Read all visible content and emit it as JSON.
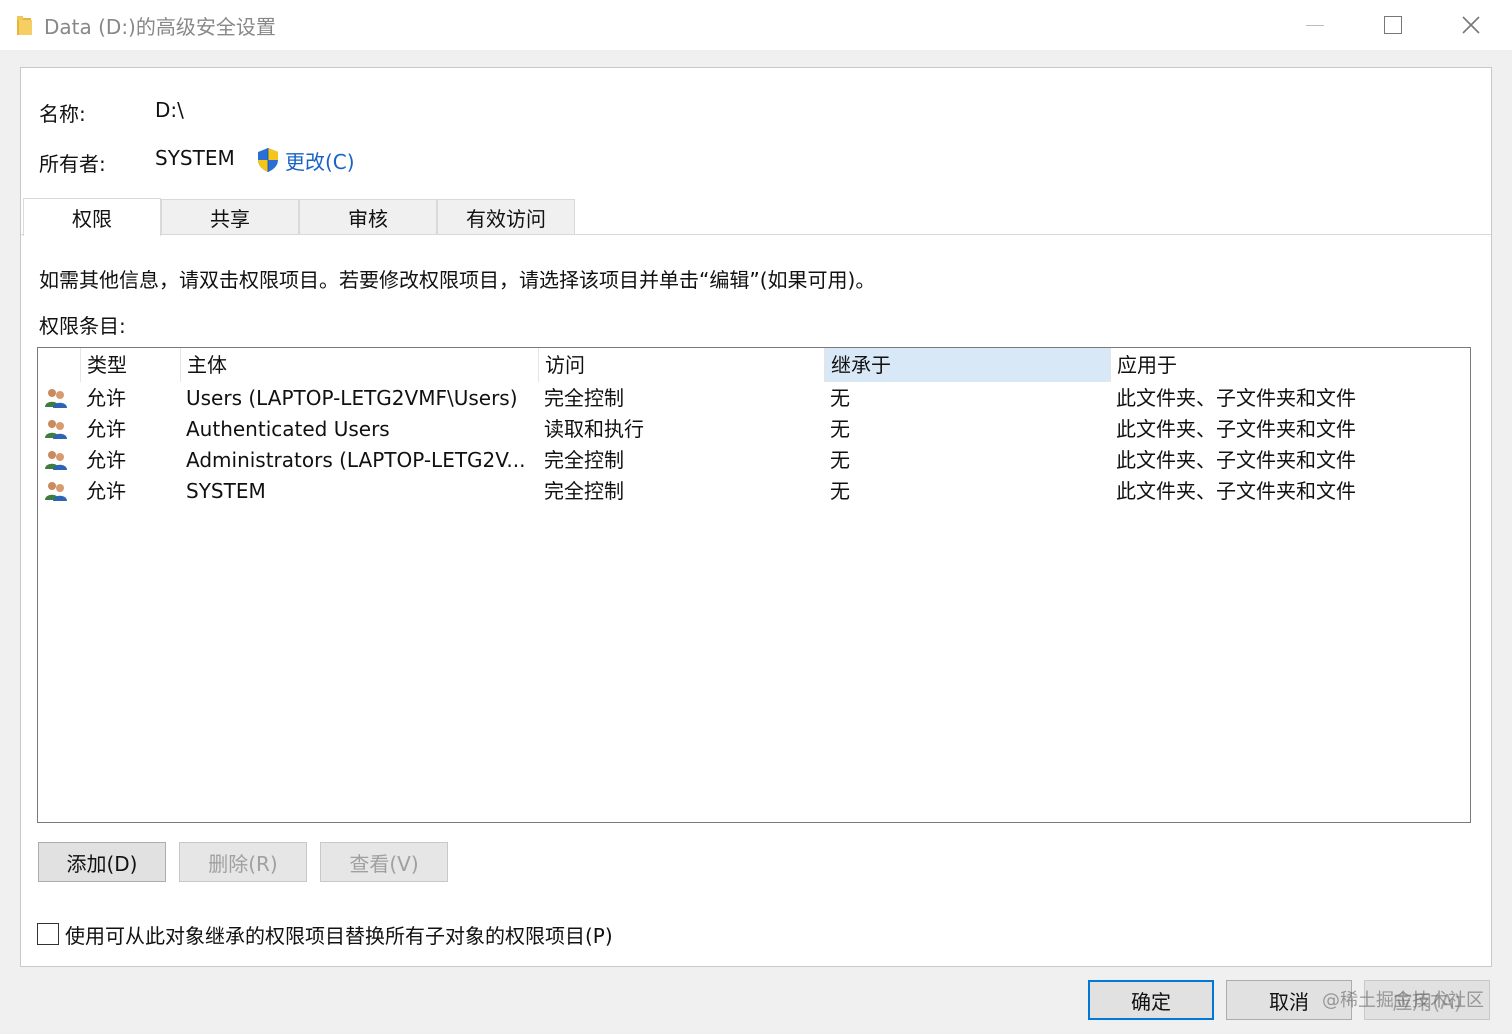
{
  "window": {
    "title": "Data (D:)的高级安全设置"
  },
  "owner_section": {
    "name_label": "名称:",
    "name_value": "D:\\",
    "owner_label": "所有者:",
    "owner_value": "SYSTEM",
    "change_link": "更改(C)"
  },
  "tabs": [
    {
      "label": "权限",
      "active": true
    },
    {
      "label": "共享",
      "active": false
    },
    {
      "label": "审核",
      "active": false
    },
    {
      "label": "有效访问",
      "active": false
    }
  ],
  "info_text": "如需其他信息，请双击权限项目。若要修改权限项目，请选择该项目并单击“编辑”(如果可用)。",
  "entries_label": "权限条目:",
  "table": {
    "columns": [
      "类型",
      "主体",
      "访问",
      "继承于",
      "应用于"
    ],
    "sorted_column": "继承于",
    "rows": [
      {
        "type": "允许",
        "principal": "Users (LAPTOP-LETG2VMF\\Users)",
        "access": "完全控制",
        "inherited": "无",
        "applies": "此文件夹、子文件夹和文件",
        "icon": "users-group-icon"
      },
      {
        "type": "允许",
        "principal": "Authenticated Users",
        "access": "读取和执行",
        "inherited": "无",
        "applies": "此文件夹、子文件夹和文件",
        "icon": "users-group-icon"
      },
      {
        "type": "允许",
        "principal": "Administrators (LAPTOP-LETG2V...",
        "access": "完全控制",
        "inherited": "无",
        "applies": "此文件夹、子文件夹和文件",
        "icon": "users-group-icon"
      },
      {
        "type": "允许",
        "principal": "SYSTEM",
        "access": "完全控制",
        "inherited": "无",
        "applies": "此文件夹、子文件夹和文件",
        "icon": "users-group-icon"
      }
    ]
  },
  "buttons": {
    "add": "添加(D)",
    "remove": "删除(R)",
    "view": "查看(V)"
  },
  "checkbox": {
    "label": "使用可从此对象继承的权限项目替换所有子对象的权限项目(P)",
    "checked": false
  },
  "dialog_buttons": {
    "ok": "确定",
    "cancel": "取消",
    "apply": "应用(A)"
  },
  "watermark": "@稀土掘金技术社区",
  "colors": {
    "accent": "#0078d7",
    "link": "#1a63c6",
    "sorted_header": "#d9e8f7"
  }
}
